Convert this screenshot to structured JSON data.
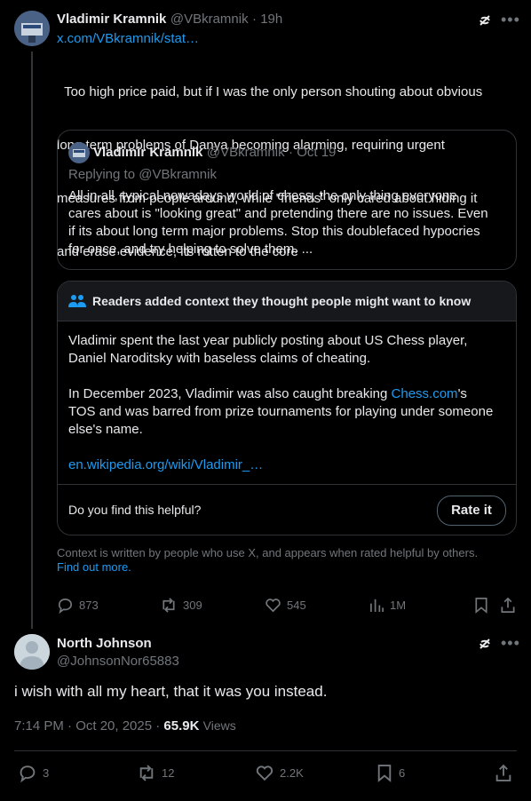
{
  "post": {
    "author_name": "Vladimir Kramnik",
    "handle": "@VBkramnik",
    "time": "· 19h",
    "link": "x.com/VBkramnik/stat…",
    "text_lines": [
      "  Too high price paid, but if I was the only person shouting about obvious",
      "long term problems of Danya becoming alarming, requiring urgent",
      "measures from people around, while \"friends\" only cared about hiding it",
      "and erase evidence, its rotten to the core"
    ],
    "quote": {
      "author_name": "Vladimir Kramnik",
      "handle": "@VBkramnik",
      "time": "· Oct 19",
      "replying": "Replying to @VBkramnik",
      "text_lines": [
        "All in all, typical nowadays world of chess, the only thing everyone",
        "cares about is \"looking great\" and pretending there are no issues. Even",
        "if its about long term major problems. Stop this doublefaced hypocries",
        "for once, and try helping to solve them. ..."
      ]
    },
    "community_note": {
      "header": "Readers added context they thought people might want to know",
      "para1_lines": [
        "Vladimir spent the last year publicly  posting about US Chess player,",
        "Daniel Naroditsky with baseless claims of cheating."
      ],
      "para2_prefix": "In December 2023, Vladimir was also caught breaking ",
      "para2_link": "Chess.com",
      "para2_suffix": "'s",
      "para2_lines": [
        "TOS and was barred from prize tournaments for playing under someone",
        "else's name."
      ],
      "source_link": "en.wikipedia.org/wiki/Vladimir_…",
      "helpful_q": "Do you find this helpful?",
      "rate_label": "Rate it"
    },
    "context_text": "Context is written by people who use X, and appears when rated helpful by others.",
    "find_out_more": "Find out more.",
    "metrics": {
      "replies": "873",
      "reposts": "309",
      "likes": "545",
      "views": "1M"
    }
  },
  "reply": {
    "author_name": "North Johnson",
    "handle": "@JohnsonNor65883",
    "text": "i wish with all my heart, that it was you instead.",
    "timestamp": "7:14 PM · Oct 20, 2025 · ",
    "views_count": "65.9K",
    "views_label": "Views",
    "metrics": {
      "replies": "3",
      "reposts": "12",
      "likes": "2.2K",
      "bookmarks": "6"
    }
  },
  "colors": {
    "accent": "#1d9bf0",
    "muted": "#71767b",
    "background": "#000000"
  },
  "icons": [
    "grok-icon",
    "more-icon",
    "reply-icon",
    "repost-icon",
    "like-icon",
    "views-icon",
    "bookmark-icon",
    "share-icon",
    "community-notes-icon"
  ]
}
